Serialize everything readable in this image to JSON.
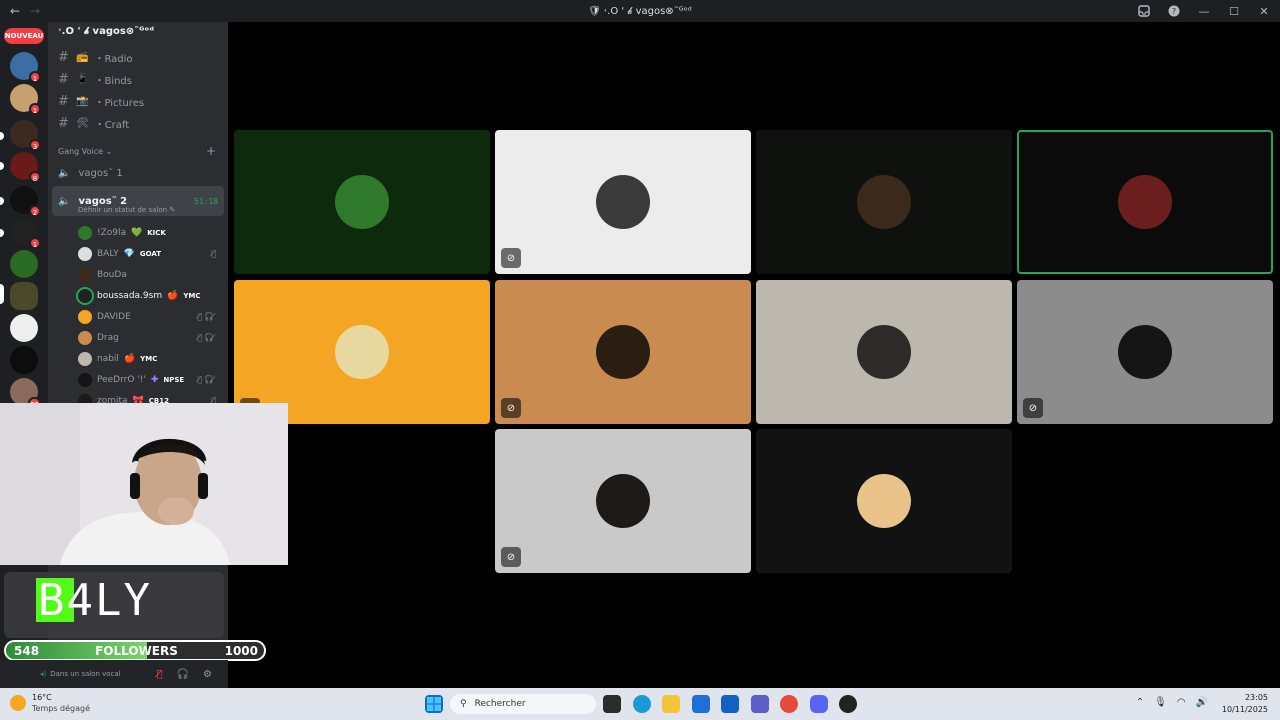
{
  "titlebar": {
    "title": "🛡 ˓.O ' 𝓫 vagos⊗˜ᴳᵒᵈ",
    "back": "←",
    "forward": "→",
    "inbox_icon": "inbox-icon",
    "help_icon": "help-icon",
    "minimize": "—",
    "maximize": "☐",
    "close": "✕"
  },
  "servers": {
    "nouveau_label": "NOUVEAU",
    "badges": [
      "1",
      "1",
      "3",
      "8",
      "2",
      "1",
      "20"
    ]
  },
  "sidebar": {
    "guild_name": "˓.O ' 𝓫 vagos⊗˜ᴳᵒᵈ",
    "text_channels": [
      {
        "emoji": "📻",
        "name": "・Radio"
      },
      {
        "emoji": "📱",
        "name": "・Binds"
      },
      {
        "emoji": "📸",
        "name": "・Pictures"
      },
      {
        "emoji": "🛠",
        "name": "・Craft"
      }
    ],
    "category": "Gang Voice",
    "voice_channels": [
      {
        "name": "vagos˜ 1",
        "active": false
      },
      {
        "name": "vagos˜ 2",
        "active": true,
        "timer": "51:18",
        "status": "Définir un statut de salon"
      }
    ],
    "members": [
      {
        "name": "!Zo9la",
        "tag": "KICK",
        "tag_icon": "💚",
        "icons": ""
      },
      {
        "name": "BALY",
        "tag": "GOAT",
        "tag_icon": "💎",
        "icons": "🎙̸"
      },
      {
        "name": "BouDa",
        "tag": "",
        "tag_icon": "",
        "icons": ""
      },
      {
        "name": "boussada.9sm",
        "tag": "YMC",
        "tag_icon": "🍎",
        "icons": ""
      },
      {
        "name": "DAVIDE",
        "tag": "",
        "tag_icon": "",
        "icons": "🎙̸🎧̸"
      },
      {
        "name": "Drag",
        "tag": "",
        "tag_icon": "",
        "icons": "🎙̸🎧̸"
      },
      {
        "name": "nabil",
        "tag": "YMC",
        "tag_icon": "🍎",
        "icons": ""
      },
      {
        "name": "PeeDrrO '!'",
        "tag": "NPSE",
        "tag_icon": "✚",
        "icons": "🎙̸🎧̸"
      },
      {
        "name": "zomita",
        "tag": "CB12",
        "tag_icon": "🎀",
        "icons": "🎙̸"
      }
    ],
    "voice_status": "Dans un salon vocal"
  },
  "stream_overlay": {
    "name": "B4LY",
    "followers_current": "548",
    "followers_label": "FOLLOWERS",
    "followers_goal": "1000",
    "progress": 0.548
  },
  "tiles": [
    {
      "bg": "#0e2a0c",
      "avatar_color": "#2f7a2a",
      "muted": false,
      "speaking": false
    },
    {
      "bg": "#ececec",
      "avatar_color": "#3a3a3a",
      "muted": true,
      "speaking": false
    },
    {
      "bg": "#0f110f",
      "avatar_color": "#3b2a1c",
      "muted": false,
      "speaking": false
    },
    {
      "bg": "#0b0b0c",
      "avatar_color": "#6b1e1e",
      "muted": false,
      "speaking": true
    },
    {
      "bg": "#f3a523",
      "avatar_color": "#e8d9a0",
      "muted": true,
      "speaking": false
    },
    {
      "bg": "#c98b4f",
      "avatar_color": "#2a1e12",
      "muted": true,
      "speaking": false
    },
    {
      "bg": "#bdb8ad",
      "avatar_color": "#2c2b29",
      "muted": false,
      "speaking": false
    },
    {
      "bg": "#8c8c8c",
      "avatar_color": "#151515",
      "muted": true,
      "speaking": false
    },
    {
      "bg": "#c9c9c9",
      "avatar_color": "#1d1a17",
      "muted": true,
      "speaking": false
    },
    {
      "bg": "#121212",
      "avatar_color": "#e9c38a",
      "muted": false,
      "speaking": false
    }
  ],
  "taskbar": {
    "temperature": "16°C",
    "weather": "Temps dégagé",
    "search_placeholder": "Rechercher",
    "time": "23:05",
    "date": "10/11/2025"
  }
}
